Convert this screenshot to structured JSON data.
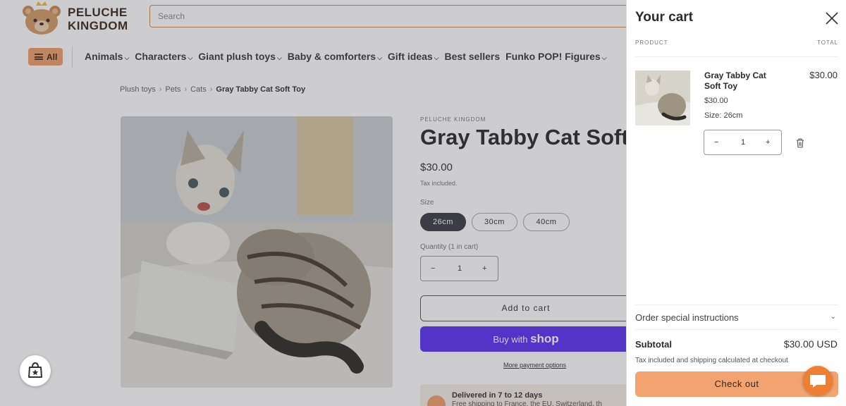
{
  "brand": {
    "line1": "PELUCHE",
    "line2": "KINGDOM"
  },
  "search": {
    "placeholder": "Search"
  },
  "nav": {
    "all_label": "All",
    "items": [
      "Animals",
      "Characters",
      "Giant plush toys",
      "Baby & comforters",
      "Gift ideas",
      "Best sellers",
      "Funko POP! Figures"
    ],
    "has_dropdown": [
      true,
      true,
      true,
      true,
      true,
      false,
      true
    ]
  },
  "breadcrumb": [
    "Plush toys",
    "Pets",
    "Cats",
    "Gray Tabby Cat Soft Toy"
  ],
  "product": {
    "vendor": "PELUCHE KINGDOM",
    "title": "Gray Tabby Cat Soft",
    "price": "$30.00",
    "tax_note": "Tax included.",
    "size_label": "Size",
    "sizes": [
      "26cm",
      "30cm",
      "40cm"
    ],
    "selected_size": "26cm",
    "quantity_label": "Quantity (1 in cart)",
    "quantity": "1",
    "add_to_cart": "Add to cart",
    "buy_with": "Buy with",
    "shop_word": "shop",
    "more_payment": "More payment options",
    "delivery_title": "Delivered in 7 to 12 days",
    "delivery_sub": "Free shipping to France, the EU, Switzerland, th"
  },
  "cart": {
    "title": "Your cart",
    "col_product": "PRODUCT",
    "col_total": "TOTAL",
    "item": {
      "name": "Gray Tabby Cat Soft Toy",
      "price": "$30.00",
      "size": "Size: 26cm",
      "quantity": "1",
      "total": "$30.00"
    },
    "instructions": "Order special instructions",
    "subtotal_label": "Subtotal",
    "subtotal_value": "$30.00 USD",
    "note": "Tax included and shipping calculated at checkout",
    "checkout": "Check out"
  },
  "colors": {
    "accent": "#ee9f6d",
    "shop_pay": "#5a31f4",
    "checkout": "#f2a36f",
    "chat": "#ee7f32"
  },
  "icons": [
    "bear-logo-icon",
    "menu-icon",
    "close-icon",
    "minus-icon",
    "plus-icon",
    "trash-icon",
    "chevron-down-icon",
    "shopping-bag-icon",
    "chat-icon",
    "truck-icon"
  ]
}
